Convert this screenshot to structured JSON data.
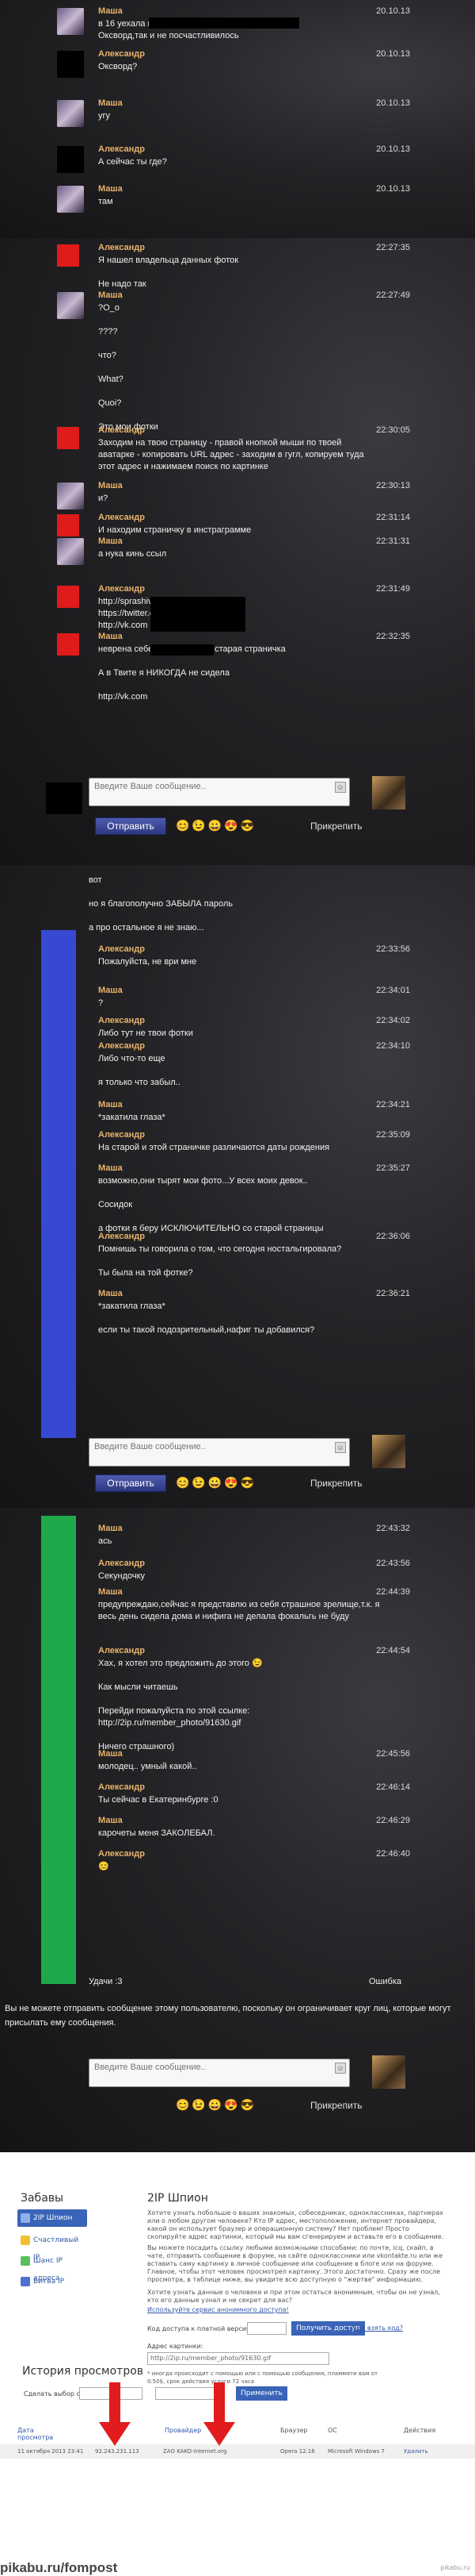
{
  "panel1": {
    "messages": [
      {
        "name": "Маша",
        "time": "20.10.13",
        "text": "в 16 уехала в\nОксворд,так и не посчастливилось"
      },
      {
        "name": "Александр",
        "time": "20.10.13",
        "text": "Оксворд?"
      },
      {
        "name": "Маша",
        "time": "20.10.13",
        "text": "угу"
      },
      {
        "name": "Александр",
        "time": "20.10.13",
        "text": "А сейчас ты где?"
      },
      {
        "name": "Маша",
        "time": "20.10.13",
        "text": "там"
      }
    ]
  },
  "panel2": {
    "messages": [
      {
        "name": "Александр",
        "time": "22:27:35",
        "text": "Я нашел владельца данных фоток\n\nНе надо так"
      },
      {
        "name": "Маша",
        "time": "22:27:49",
        "text": "?O_o\n\n????\n\nчто?\n\nWhat?\n\nQuoi?\n\nЭто мои фотки"
      },
      {
        "name": "Александр",
        "time": "22:30:05",
        "text": "Заходим на твою страницу - правой кнопкой мыши по твоей аватарке - копировать URL адрес - заходим в гугл, копируем туда этот адрес и нажимаем поиск по картинке"
      },
      {
        "name": "Маша",
        "time": "22:30:13",
        "text": "и?"
      },
      {
        "name": "Александр",
        "time": "22:31:14",
        "text": "И находим страничку в инстраграмме"
      },
      {
        "name": "Маша",
        "time": "22:31:31",
        "text": "а нука кинь ссыл"
      },
      {
        "name": "Александр",
        "time": "22:31:49",
        "text": "http://sprashivai.ru\nhttps://twitter.com\nhttp://vk.com"
      },
      {
        "name": "Маша",
        "time": "22:32:35",
        "text": "неврена себе.. У меня была старая страничка\n\nА в Твите я НИКОГДА не сидела\n\nhttp://vk.com"
      }
    ],
    "compose_placeholder": "Введите Ваше сообщение..",
    "send_label": "Отправить",
    "pin_label": "Прикрепить"
  },
  "panel3": {
    "head_text": "вот\n\nно я благополучно ЗАБЫЛА пароль\n\nа про остальное я не знаю...",
    "messages": [
      {
        "name": "Александр",
        "time": "22:33:56",
        "text": "Пожалуйста, не ври мне"
      },
      {
        "name": "Маша",
        "time": "22:34:01",
        "text": "?"
      },
      {
        "name": "Александр",
        "time": "22:34:02",
        "text": "Либо тут не твои фотки"
      },
      {
        "name": "Александр",
        "time": "22:34:10",
        "text": "Либо что-то еще\n\nя только что забыл.."
      },
      {
        "name": "Маша",
        "time": "22:34:21",
        "text": "*закатила глаза*"
      },
      {
        "name": "Александр",
        "time": "22:35:09",
        "text": "На старой и этой страничке различаются даты рождения"
      },
      {
        "name": "Маша",
        "time": "22:35:27",
        "text": "возможно,они тырят мои фото...У всех моих девок..\n\nСосидок\n\nа фотки я беру ИСКЛЮЧИТЕЛЬНО со старой страницы"
      },
      {
        "name": "Александр",
        "time": "22:36:06",
        "text": "Помнишь ты говорила о том, что сегодня ностальгировала?\n\nТы была на той фотке?"
      },
      {
        "name": "Маша",
        "time": "22:36:21",
        "text": "*закатила глаза*\n\nесли ты такой подозрительный,нафиг ты добавился?"
      }
    ],
    "compose_placeholder": "Введите Ваше сообщение..",
    "send_label": "Отправить",
    "pin_label": "Прикрепить"
  },
  "panel4": {
    "messages": [
      {
        "name": "Маша",
        "time": "22:43:32",
        "text": "ась"
      },
      {
        "name": "Александр",
        "time": "22:43:56",
        "text": "Секундочку"
      },
      {
        "name": "Маша",
        "time": "22:44:39",
        "text": "предупреждаю,сейчас я представлю из себя страшное зрелище,т.к. я весь день сидела дома и нифига не делала фокальгь не буду"
      },
      {
        "name": "Александр",
        "time": "22:44:54",
        "text": "Хах, я хотел это предложить до этого 😉\n\nКак мысли читаешь\n\nПерейди пожалуйста по этой ссылке:\nhttp://2ip.ru/member_photo/91630.gif\n\nНичего страшного)"
      },
      {
        "name": "Маша",
        "time": "22:45:56",
        "text": "молодец.. умный какой.."
      },
      {
        "name": "Александр",
        "time": "22:46:14",
        "text": "Ты сейчас в Екатеринбурге :0"
      },
      {
        "name": "Маша",
        "time": "22:46:29",
        "text": "карочеты меня ЗАКОЛЕБАЛ."
      },
      {
        "name": "Александр",
        "time": "22:46:40",
        "text": "😊"
      }
    ],
    "bottom_left": "Удачи :3",
    "bottom_right": "Ошибка",
    "note": "Вы не можете отправить сообщение этому пользователю, поскольку он ограничивает круг лиц, которые могут присылать ему сообщения.",
    "compose_placeholder": "Введите Ваше сообщение..",
    "pin_label": "Прикрепить"
  },
  "web": {
    "sidebar_title": "Забавы",
    "sidebar_items": [
      "2IP Шпион",
      "Счастливый IP",
      "Шанс IP адреса",
      "Битва IP"
    ],
    "spy_title": "2IP Шпион",
    "spy_text_1": "Хотите узнать побольше о ваших знакомых, собеседниках, одноклассниках, партнерах или о любом другом человеке? Кто IP адрес, местоположение, интернет провайдера, какой он использует браузер и операционную систему? Нет проблем! Просто скопируйте адрес картинки, который мы вам сгенерируем и вставьте его в сообщение.",
    "spy_text_2": "Вы можете посадить ссылку любыми возможными способами: по почте, icq, скайп, в чате, отправить сообщение в форуме, на сайте одноклассники или vkontakte.ru или же вставить саму картинку в личное сообщение или сообщение в блоге или на форуме. Главное, чтобы этот человек просмотрел картинку. Этого достаточно. Сразу же после просмотра, в таблице ниже, вы увидите всю доступную о \"жертве\" информацию.",
    "spy_text_3": "Хотите узнать данные о человеке и при этом остаться анонимным, чтобы он не узнал, кто его данные узнал и не секрет для вас?",
    "spy_link": "Используйте сервис анонимного доступа!",
    "code_label": "Код доступа к платной версии:",
    "get_access": "Получить доступ",
    "where_code": "Где взять код?",
    "img_addr_label": "Адрес картинки:",
    "img_addr_value": "http://2ip.ru/member_photo/91630.gif",
    "footnote": "* иногда происходит с помощью или с помощью сообщения, пламмяти вам от 0.50$, срок действия услуги 72 часа",
    "apply_label": "Применить",
    "history_title": "История просмотров",
    "history_select_label": "Сделать выбор с:",
    "cols": [
      "Дата просмотра",
      "IP",
      "Провайдер",
      "Браузер",
      "ОС",
      "Действия"
    ],
    "row": [
      "11 октября 2013 23:41",
      "92.243.231.113",
      "ZAO KAKO-Internet.org",
      "Opera 12.16",
      "Microsoft Windows 7",
      "Удалить"
    ],
    "watermark": "pikabu.ru/fompost",
    "pikabu": "pikabu.ru"
  }
}
